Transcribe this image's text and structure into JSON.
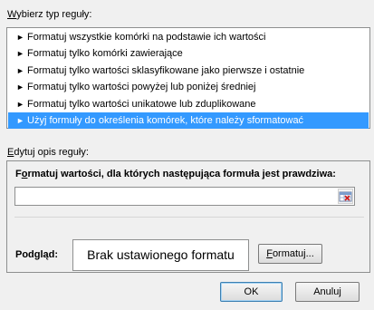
{
  "rule_type": {
    "label_accel": "W",
    "label_rest": "ybierz typ reguły:",
    "items": [
      {
        "label": "Formatuj wszystkie komórki na podstawie ich wartości",
        "selected": false
      },
      {
        "label": "Formatuj tylko komórki zawierające",
        "selected": false
      },
      {
        "label": "Formatuj tylko wartości sklasyfikowane jako pierwsze i ostatnie",
        "selected": false
      },
      {
        "label": "Formatuj tylko wartości powyżej lub poniżej średniej",
        "selected": false
      },
      {
        "label": "Formatuj tylko wartości unikatowe lub zduplikowane",
        "selected": false
      },
      {
        "label": "Użyj formuły do określenia komórek, które należy sformatować",
        "selected": true
      }
    ],
    "bullet_glyph": "►"
  },
  "edit": {
    "label_accel": "E",
    "label_rest": "dytuj opis reguły:",
    "formula_label_pre": "F",
    "formula_label_accel": "o",
    "formula_label_rest": "rmatuj wartości, dla których następująca formuła jest prawdziwa:",
    "formula_value": "",
    "ref_icon": "range-selector-icon",
    "preview_label": "Podgląd:",
    "preview_text": "Brak ustawionego formatu",
    "format_accel": "F",
    "format_rest": "ormatuj..."
  },
  "footer": {
    "ok_label": "OK",
    "cancel_label": "Anuluj"
  },
  "colors": {
    "selection": "#3399ff",
    "dialog_bg": "#f0f0f0"
  }
}
